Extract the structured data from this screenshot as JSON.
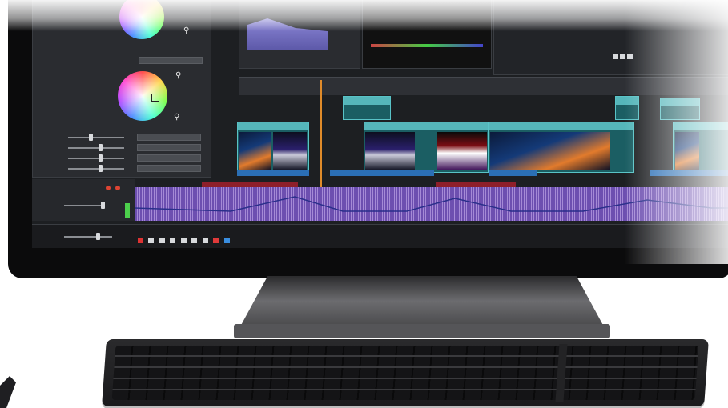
{
  "colors": {
    "screen_bg": "#1d1f22",
    "clip_teal": "#55b6ba",
    "audio_purple": "#6d4fb0",
    "timeline_blue": "#2b6fb5",
    "timeline_red": "#8e1f2a"
  },
  "icons": [
    "color-wheel-icon",
    "eyedropper-icon",
    "play-icon",
    "pause-icon",
    "stop-icon",
    "speaker-icon"
  ]
}
